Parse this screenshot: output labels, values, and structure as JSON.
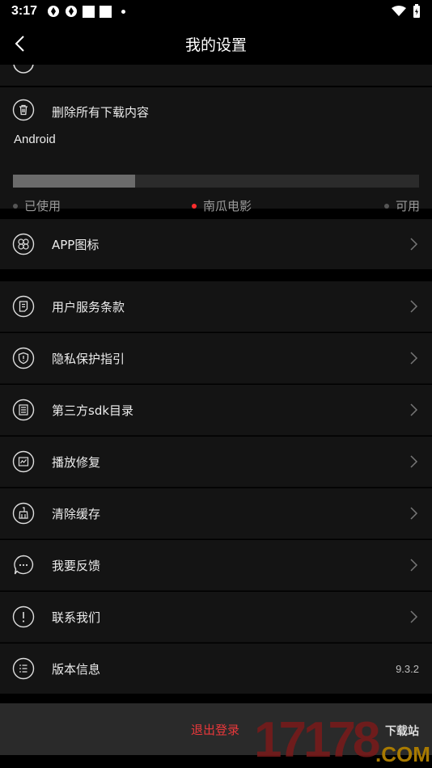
{
  "status_bar": {
    "time": "3:17"
  },
  "header": {
    "title": "我的设置"
  },
  "storage": {
    "delete_label": "删除所有下载内容",
    "device_label": "Android",
    "used_fraction": 0.3,
    "legend": {
      "used": "已使用",
      "app": "南瓜电影",
      "free": "可用"
    }
  },
  "rows": [
    {
      "label": "APP图标",
      "icon": "app-grid-icon"
    },
    {
      "label": "用户服务条款",
      "icon": "document-icon"
    },
    {
      "label": "隐私保护指引",
      "icon": "shield-icon"
    },
    {
      "label": "第三方sdk目录",
      "icon": "list-icon"
    },
    {
      "label": "播放修复",
      "icon": "repair-icon"
    },
    {
      "label": "清除缓存",
      "icon": "broom-icon"
    },
    {
      "label": "我要反馈",
      "icon": "chat-icon"
    },
    {
      "label": "联系我们",
      "icon": "alert-icon"
    },
    {
      "label": "版本信息",
      "icon": "info-list-icon",
      "value": "9.3.2"
    }
  ],
  "footer": {
    "logout_label": "退出登录"
  },
  "watermark": {
    "number": "17178",
    "text": "下载站",
    "domain": ".COM"
  },
  "colors": {
    "logout": "#e8383b",
    "app_dot": "#ff2d2d",
    "row_bg": "#141414"
  }
}
